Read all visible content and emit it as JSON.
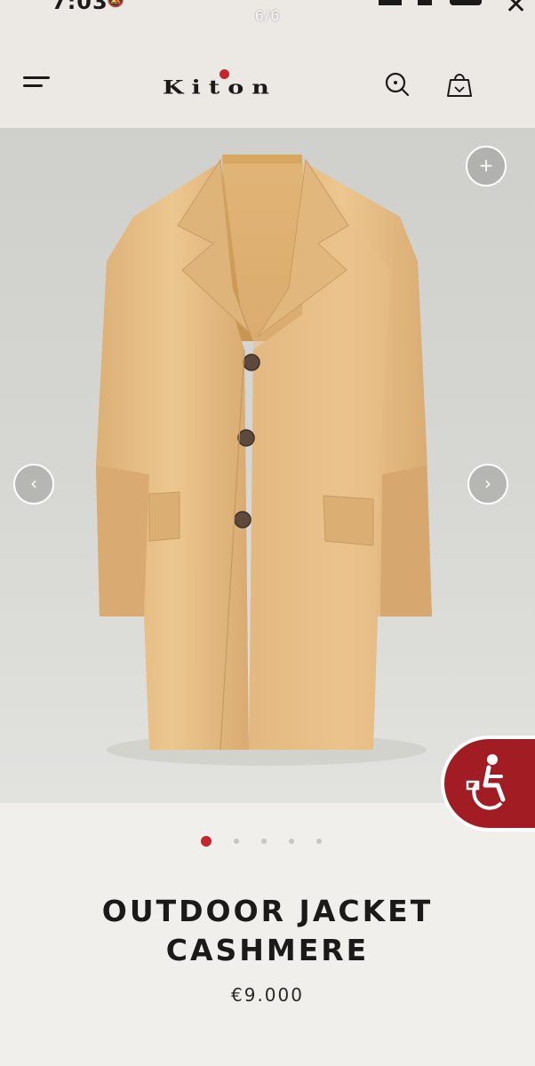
{
  "status_bar": {
    "time": "7:03",
    "counter": "6/6",
    "close_glyph": "✕",
    "mute_icon": "bell-slash-icon"
  },
  "header": {
    "logo_text": "Kiton",
    "menu_icon": "hamburger-menu-icon",
    "search_icon": "search-icon",
    "bag_icon": "shopping-bag-icon"
  },
  "gallery": {
    "zoom_label": "+",
    "prev_label": "‹",
    "next_label": "›",
    "image_subject": "camel cashmere overcoat"
  },
  "carousel": {
    "count": 5,
    "active_index": 0
  },
  "product": {
    "title_line1": "OUTDOOR JACKET",
    "title_line2": "CASHMERE",
    "price": "€9.000"
  },
  "colors": {
    "brand_red": "#c1272d",
    "accessibility_red": "#a11c23",
    "coat_camel": "#e6bd81"
  }
}
